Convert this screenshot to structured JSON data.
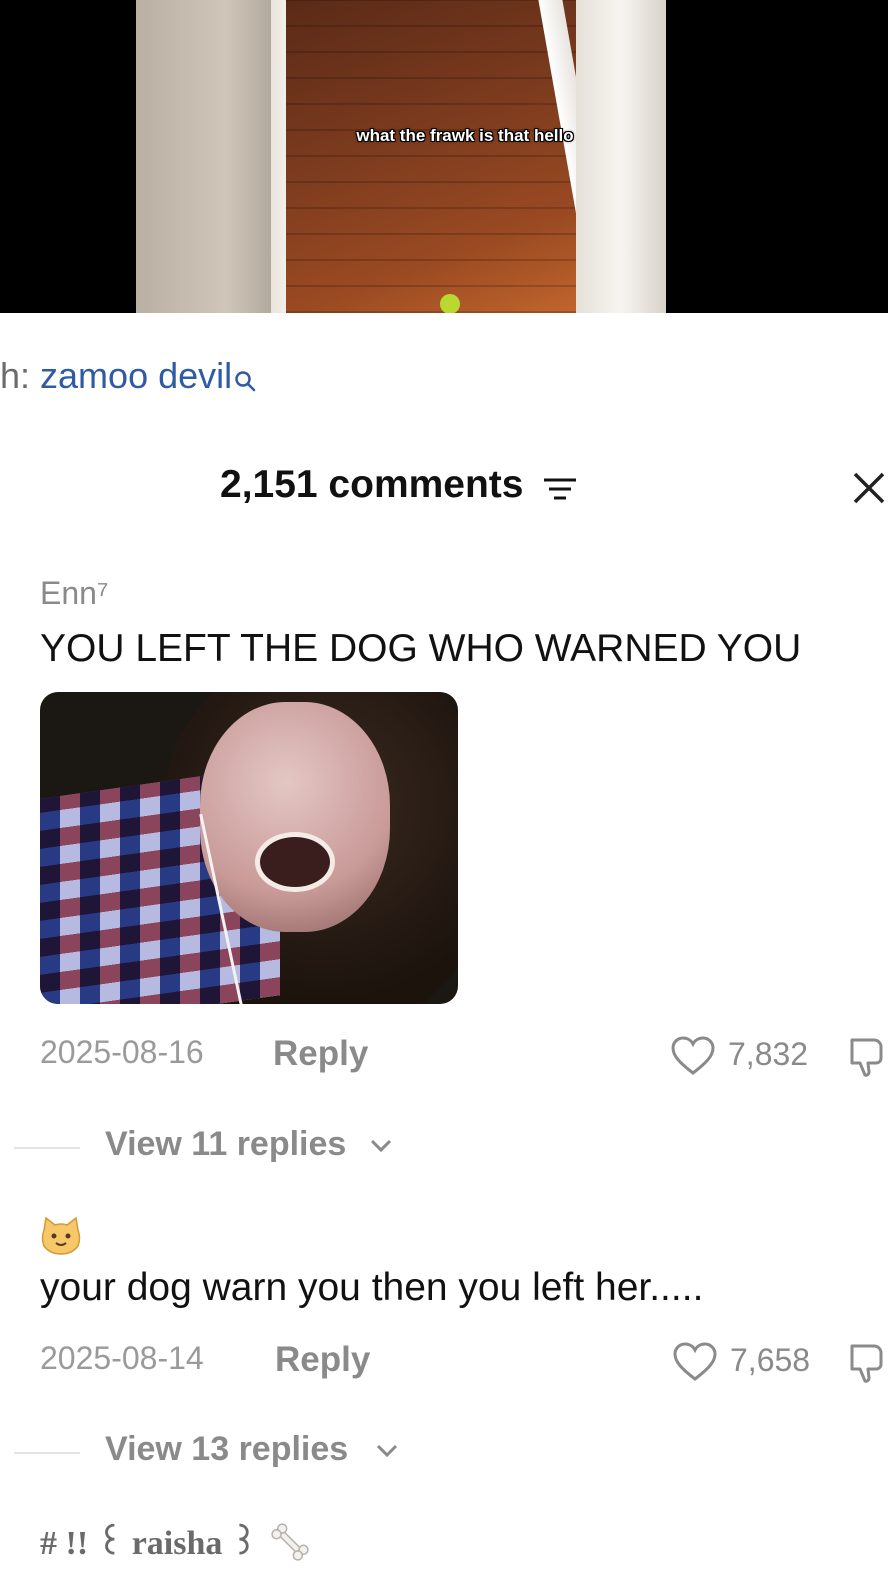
{
  "video": {
    "caption": "what the frawk is that hello"
  },
  "search": {
    "prefix": "h: ",
    "query": "zamoo devil",
    "icon": "search-icon"
  },
  "comments_header": {
    "count_label": "2,151 comments",
    "filter_icon": "filter-icon",
    "close_icon": "close-icon"
  },
  "comments": [
    {
      "username": "Enn⁷",
      "text": "YOU LEFT THE DOG WHO WARNED YOU",
      "date": "2025-08-16",
      "reply_label": "Reply",
      "likes": "7,832",
      "view_replies": "View 11 replies"
    },
    {
      "avatar": "cat-face-emoji",
      "text": "your dog warn you then you left her.....",
      "date": "2025-08-14",
      "reply_label": "Reply",
      "likes": "7,658",
      "view_replies": "View 13 replies"
    }
  ],
  "next_comment": {
    "username": "# !! ꒰ raisha ꒱"
  },
  "colors": {
    "link_blue": "#2f5aa4",
    "muted_text": "#8a8a8a",
    "text": "#111111"
  }
}
